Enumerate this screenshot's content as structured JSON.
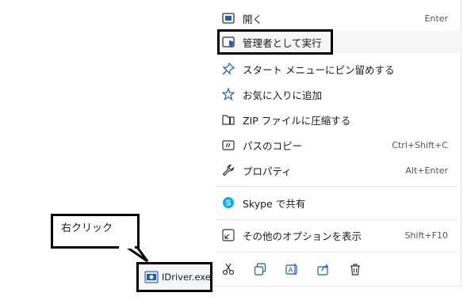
{
  "menu": {
    "items": [
      {
        "label": "開く",
        "shortcut": "Enter",
        "icon": "open-icon"
      },
      {
        "label": "管理者として実行",
        "shortcut": "",
        "icon": "admin-shield-icon"
      },
      {
        "label": "スタート メニューにピン留めする",
        "shortcut": "",
        "icon": "pin-icon"
      },
      {
        "label": "お気に入りに追加",
        "shortcut": "",
        "icon": "star-icon"
      },
      {
        "label": "ZIP ファイルに圧縮する",
        "shortcut": "",
        "icon": "zip-folder-icon"
      },
      {
        "label": "パスのコピー",
        "shortcut": "Ctrl+Shift+C",
        "icon": "copy-path-icon"
      },
      {
        "label": "プロパティ",
        "shortcut": "Alt+Enter",
        "icon": "wrench-icon"
      },
      {
        "label": "Skype で共有",
        "shortcut": "",
        "icon": "skype-icon"
      },
      {
        "label": "その他のオプションを表示",
        "shortcut": "Shift+F10",
        "icon": "more-options-icon"
      }
    ],
    "toolbar": [
      "cut-icon",
      "copy-icon",
      "rename-icon",
      "share-icon",
      "delete-icon"
    ]
  },
  "callout": {
    "text": "右クリック"
  },
  "file": {
    "name": "IDriver.exe"
  },
  "colors": {
    "accent": "#1a5fb4",
    "skype": "#00aff0"
  }
}
